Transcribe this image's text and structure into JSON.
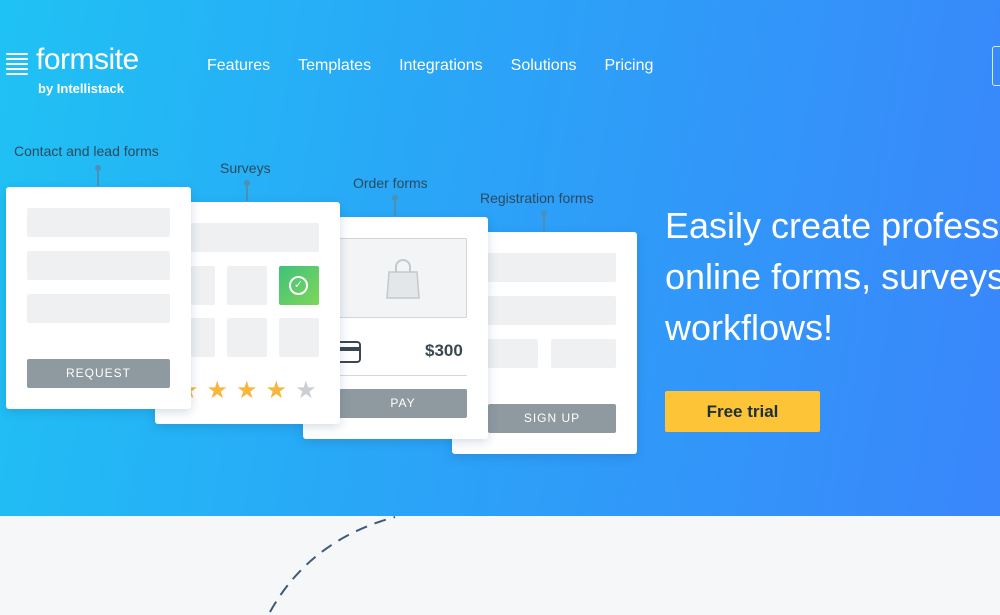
{
  "brand": {
    "name": "formsite",
    "tagline": "by Intellistack"
  },
  "nav": [
    "Features",
    "Templates",
    "Integrations",
    "Solutions",
    "Pricing"
  ],
  "categories": {
    "contact": "Contact and lead forms",
    "surveys": "Surveys",
    "order": "Order forms",
    "registration": "Registration forms"
  },
  "cards": {
    "contact_button": "REQUEST",
    "order_price": "$300",
    "order_button": "PAY",
    "registration_button": "SIGN UP"
  },
  "survey_rating": {
    "filled": 4,
    "total": 5
  },
  "hero": {
    "line1": "Easily create professi",
    "line2": "online forms, surveys",
    "line3": "workflows!",
    "cta": "Free trial"
  },
  "colors": {
    "hero_gradient_start": "#1fc2f4",
    "hero_gradient_end": "#3a86fb",
    "cta": "#fcc436",
    "star": "#f6b73c",
    "check": "#3ec27a"
  },
  "icons": [
    "logo-lines-icon",
    "check-icon",
    "star-icon",
    "shopping-bag-icon",
    "credit-card-icon"
  ]
}
